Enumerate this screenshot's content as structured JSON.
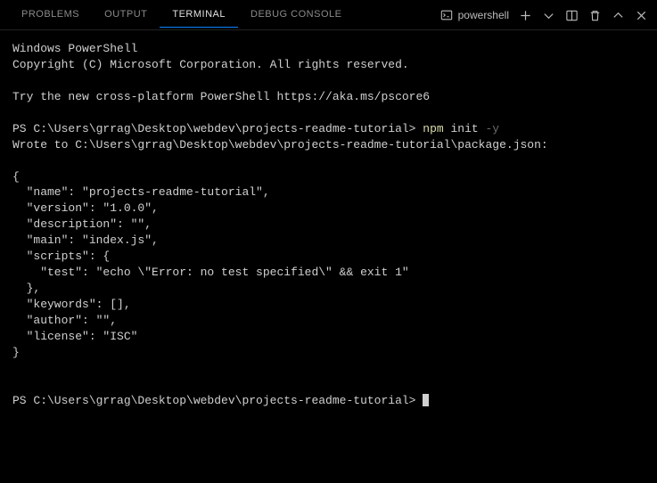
{
  "tabs": {
    "problems": "PROBLEMS",
    "output": "OUTPUT",
    "terminal": "TERMINAL",
    "debug_console": "DEBUG CONSOLE"
  },
  "toolbar": {
    "shell_name": "powershell"
  },
  "terminal": {
    "line01": "Windows PowerShell",
    "line02": "Copyright (C) Microsoft Corporation. All rights reserved.",
    "line03": "",
    "line04": "Try the new cross-platform PowerShell https://aka.ms/pscore6",
    "line05": "",
    "prompt1_prefix": "PS C:\\Users\\grrag\\Desktop\\webdev\\projects-readme-tutorial> ",
    "prompt1_cmd": "npm",
    "prompt1_arg1": " init ",
    "prompt1_arg2": "-y",
    "line07": "Wrote to C:\\Users\\grrag\\Desktop\\webdev\\projects-readme-tutorial\\package.json:",
    "line08": "",
    "line09": "{",
    "line10": "  \"name\": \"projects-readme-tutorial\",",
    "line11": "  \"version\": \"1.0.0\",",
    "line12": "  \"description\": \"\",",
    "line13": "  \"main\": \"index.js\",",
    "line14": "  \"scripts\": {",
    "line15": "    \"test\": \"echo \\\"Error: no test specified\\\" && exit 1\"",
    "line16": "  },",
    "line17": "  \"keywords\": [],",
    "line18": "  \"author\": \"\",",
    "line19": "  \"license\": \"ISC\"",
    "line20": "}",
    "line21": "",
    "line22": "",
    "prompt2_prefix": "PS C:\\Users\\grrag\\Desktop\\webdev\\projects-readme-tutorial> "
  }
}
